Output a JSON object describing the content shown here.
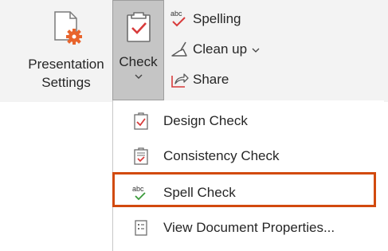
{
  "ribbon": {
    "presentation_settings": {
      "line1": "Presentation",
      "line2": "Settings",
      "icon": "presentation-settings-icon"
    },
    "check": {
      "label": "Check",
      "icon": "check-clipboard-icon"
    },
    "proofing": {
      "spelling": "Spelling",
      "clean_up": "Clean up",
      "share": "Share"
    }
  },
  "menu": {
    "items": [
      {
        "label": "Design Check",
        "icon": "design-check-icon"
      },
      {
        "label": "Consistency Check",
        "icon": "consistency-check-icon"
      },
      {
        "label": "Spell Check",
        "icon": "spell-check-icon"
      },
      {
        "label": "View Document Properties...",
        "icon": "document-properties-icon"
      }
    ]
  },
  "colors": {
    "accent_red": "#d83b3b",
    "highlight": "#d24a0e",
    "ribbon_bg": "#f3f3f3",
    "selected_bg": "#c5c5c5",
    "check_green": "#3a9a3a"
  }
}
